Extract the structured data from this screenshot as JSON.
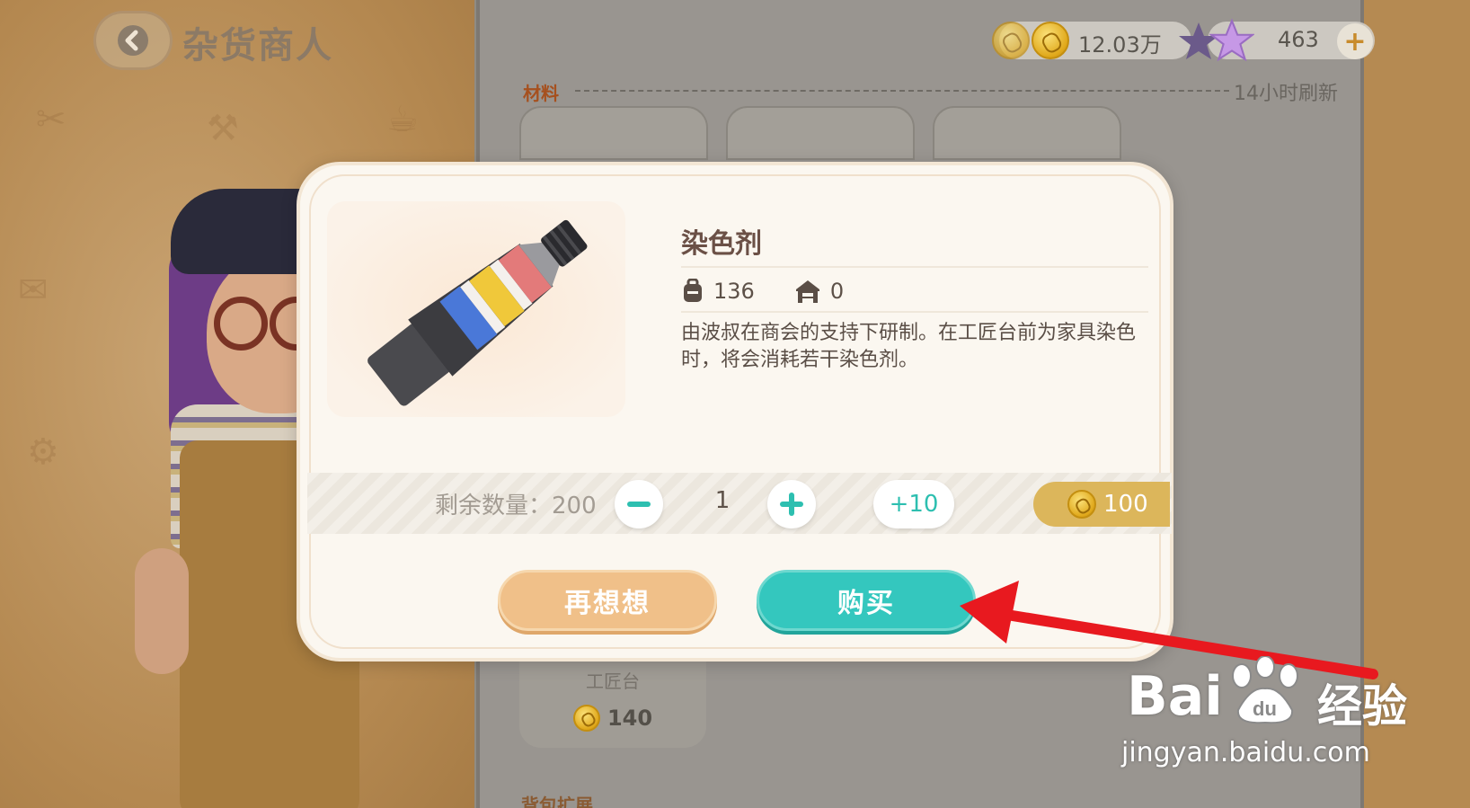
{
  "header": {
    "back_title": "杂货商人"
  },
  "currency": {
    "coins": "12.03万",
    "stars": "463"
  },
  "shop": {
    "section_materials": "材料",
    "refresh_note": "14小时刷新",
    "bottom_card_label": "工匠台",
    "bottom_card_price": "140",
    "section_bag": "背包扩展"
  },
  "dialog": {
    "item_name": "染色剂",
    "backpack_count": "136",
    "warehouse_count": "0",
    "description": "由波叔在商会的支持下研制。在工匠台前为家具染色时，将会消耗若干染色剂。",
    "remaining_label": "剩余数量：200",
    "quantity": "1",
    "plus10_label": "+10",
    "price": "100",
    "cancel_label": "再想想",
    "buy_label": "购买"
  },
  "watermark": {
    "brand": "Bai",
    "brand_suffix": "经验",
    "url": "jingyan.baidu.com"
  },
  "colors": {
    "accent_teal": "#34c7be",
    "accent_orange": "#f0c089",
    "coin_gold": "#dcb65b",
    "annotation_arrow": "#e8191f"
  }
}
